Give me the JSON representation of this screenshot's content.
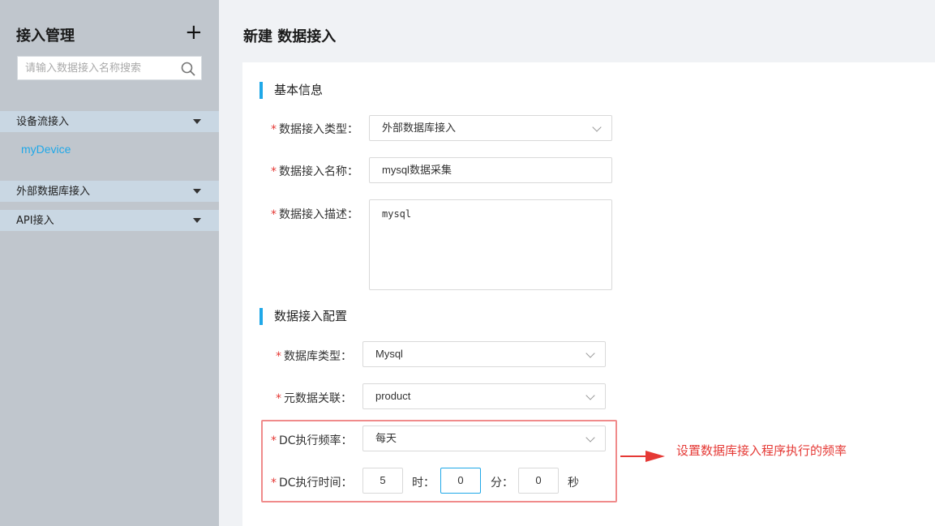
{
  "sidebar": {
    "title": "接入管理",
    "add_label": "+",
    "search_placeholder": "请输入数据接入名称搜索",
    "groups": [
      {
        "label": "设备流接入",
        "items": [
          "myDevice"
        ]
      },
      {
        "label": "外部数据库接入",
        "items": []
      },
      {
        "label": "API接入",
        "items": []
      }
    ]
  },
  "page": {
    "title": "新建 数据接入"
  },
  "basic": {
    "title": "基本信息",
    "type_label": "数据接入类型：",
    "type_value": "外部数据库接入",
    "name_label": "数据接入名称：",
    "name_value": "mysql数据采集",
    "desc_label": "数据接入描述：",
    "desc_value": "mysql"
  },
  "config": {
    "title": "数据接入配置",
    "db_type_label": "数据库类型：",
    "db_type_value": "Mysql",
    "meta_label": "元数据关联：",
    "meta_value": "product",
    "freq_label": "DC执行频率：",
    "freq_value": "每天",
    "time_label": "DC执行时间：",
    "hour_value": "5",
    "hour_unit": "时：",
    "minute_value": "0",
    "minute_unit": "分：",
    "second_value": "0",
    "second_unit": "秒"
  },
  "annotation": {
    "text": "设置数据库接入程序执行的频率",
    "color": "#e53935"
  },
  "required_mark": "*",
  "colors": {
    "accent": "#1fa8e8",
    "sidebar_bg": "#c0c6cd",
    "group_bg": "#c9d7e3",
    "required": "#e53935"
  }
}
